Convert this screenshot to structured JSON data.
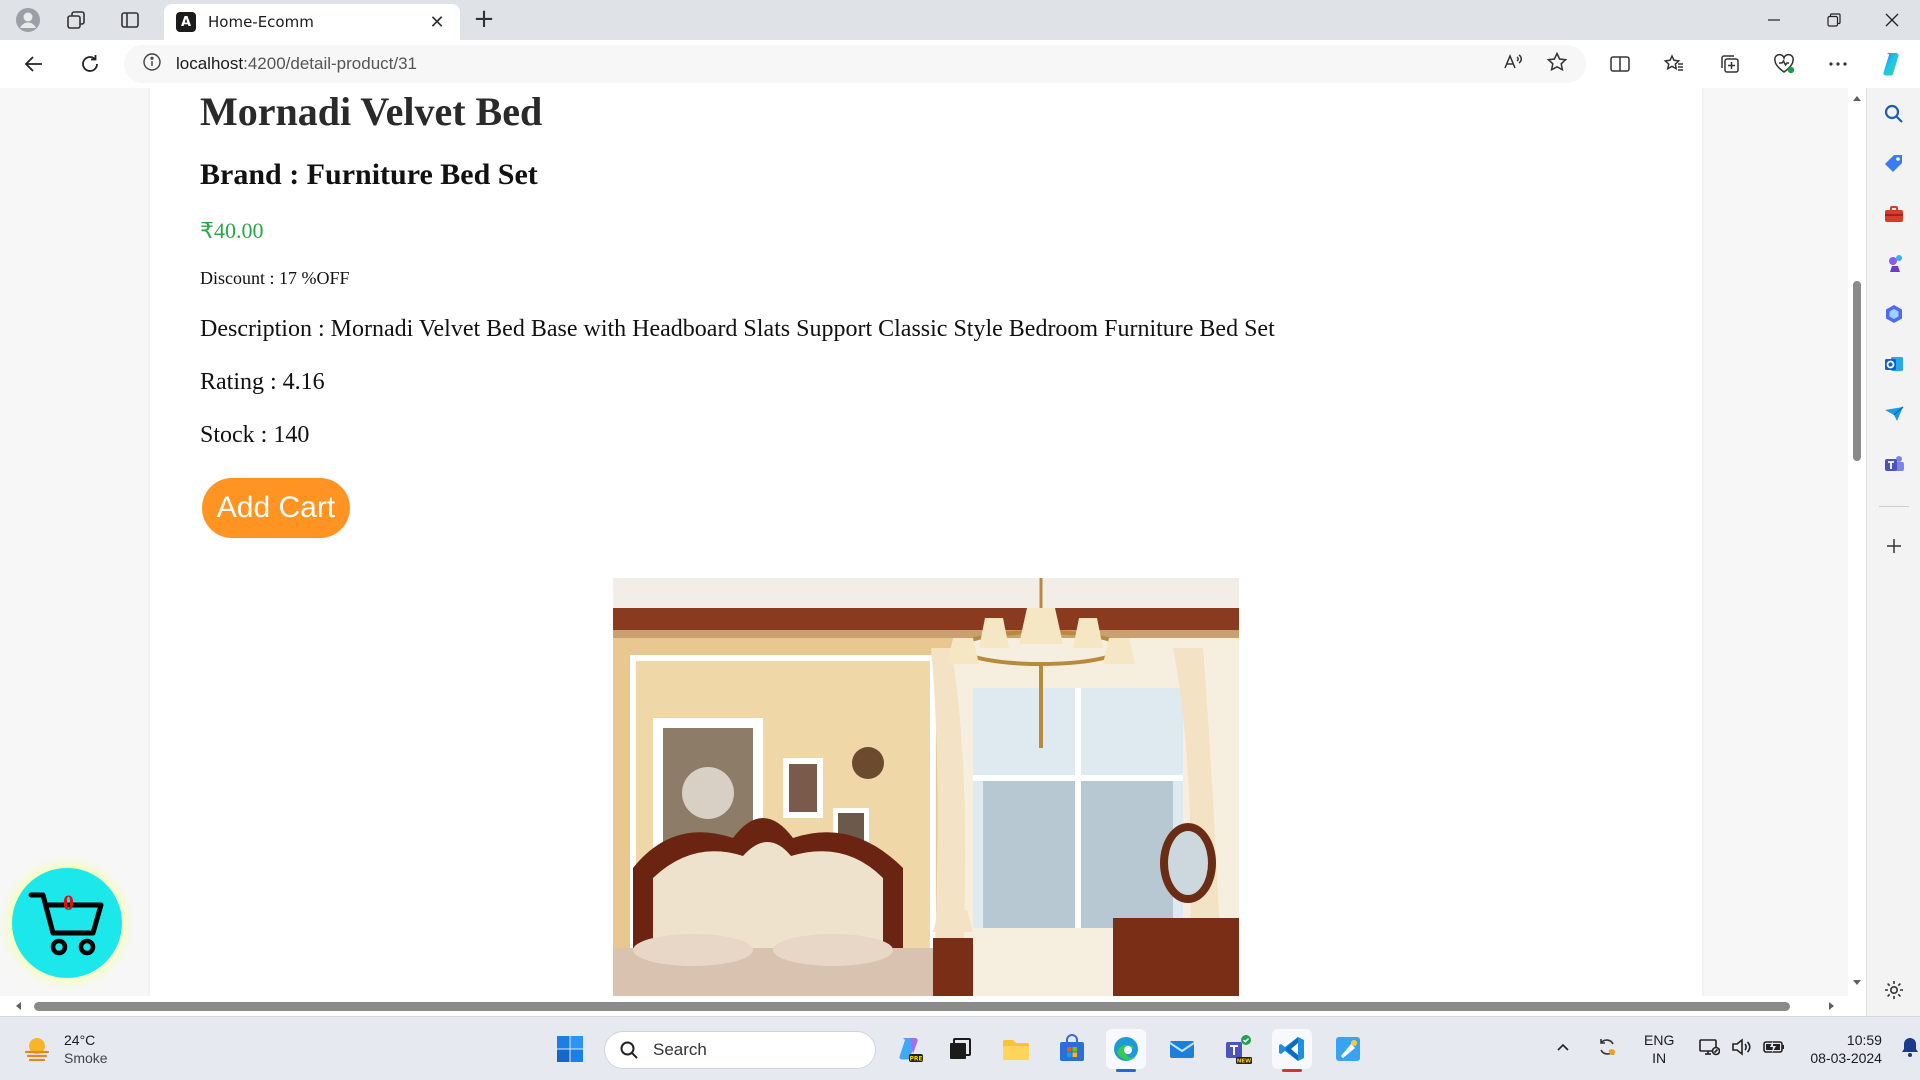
{
  "browser": {
    "tab_title": "Home-Ecomm",
    "url_host": "localhost",
    "url_path": ":4200/detail-product/31"
  },
  "product": {
    "title": "Mornadi Velvet Bed",
    "brand": "Brand : Furniture Bed Set",
    "price": "₹40.00",
    "discount": "Discount : 17 %OFF",
    "description": "Description : Mornadi Velvet Bed Base with Headboard Slats Support Classic Style Bedroom Furniture Bed Set",
    "rating": "Rating : 4.16",
    "stock": "Stock : 140",
    "add_cart_label": "Add Cart",
    "image_name": "bedroom-furniture-bed-set-photo"
  },
  "cart": {
    "count": "0"
  },
  "taskbar": {
    "weather_temp": "24°C",
    "weather_desc": "Smoke",
    "search_placeholder": "Search",
    "lang_top": "ENG",
    "lang_bottom": "IN",
    "time": "10:59",
    "date": "08-03-2024"
  },
  "colors": {
    "price_green": "#28a745",
    "add_cart_orange": "#ff9422",
    "cart_bubble": "#1ce8ec",
    "cart_count_red": "#dd1111"
  }
}
